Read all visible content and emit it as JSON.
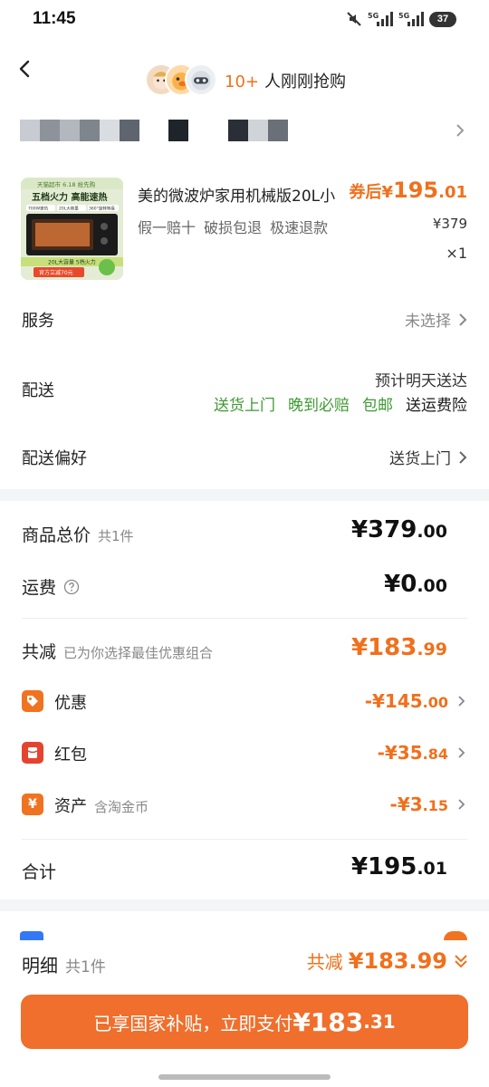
{
  "status_bar": {
    "time": "11:45",
    "battery": "37"
  },
  "header": {
    "buyers_count": "10+",
    "buyers_text": "人刚刚抢购"
  },
  "product": {
    "title": "美的微波炉家用机械版20L小",
    "tags": "假一赔十 破损包退 极速退款",
    "coupon_prefix": "券后¥",
    "coupon_int": "195",
    "coupon_dec": ".01",
    "original_price": "¥379",
    "quantity": "×1",
    "thumb": {
      "top_badge": "天猫超市 6.18 抢先购",
      "headline": "五档火力 高能速热",
      "chips": [
        "700W速热",
        "20L大容量",
        "360°旋转转盘"
      ],
      "bottom_line": "20L大容量 5档火力",
      "bottom_badge": "官方立减70元"
    }
  },
  "rows": {
    "service_label": "服务",
    "service_value": "未选择",
    "delivery_label": "配送",
    "delivery_eta": "预计明天送达",
    "delivery_tags": [
      "送货上门",
      "晚到必赔",
      "包邮"
    ],
    "delivery_insurance": "送运费险",
    "pref_label": "配送偏好",
    "pref_value": "送货上门"
  },
  "price": {
    "total_label": "商品总价",
    "total_count": "共1件",
    "total_int": "¥379",
    "total_dec": ".00",
    "freight_label": "运费",
    "freight_int": "¥0",
    "freight_dec": ".00",
    "reduce_label": "共减",
    "reduce_note": "已为你选择最佳优惠组合",
    "reduce_int": "¥183",
    "reduce_dec": ".99",
    "discounts": [
      {
        "icon_text": "⬥",
        "label": "优惠",
        "note": "",
        "int": "-¥145",
        "dec": ".00"
      },
      {
        "icon_text": "▤",
        "label": "红包",
        "note": "",
        "int": "-¥35",
        "dec": ".84"
      },
      {
        "icon_text": "¥",
        "label": "资产",
        "note": "含淘金币",
        "int": "-¥3",
        "dec": ".15"
      }
    ],
    "sum_label": "合计",
    "sum_int": "¥195",
    "sum_dec": ".01"
  },
  "bottom": {
    "detail_label": "明细",
    "detail_count": "共1件",
    "detail_reduce_prefix": "共减",
    "detail_reduce_value": "¥183.99",
    "pay_label": "已享国家补贴，立即支付",
    "pay_int": "¥183",
    "pay_dec": ".31"
  },
  "colors": {
    "accent": "#f0701c",
    "green": "#3e9a32",
    "button": "#f06f2c"
  },
  "icons": [
    "back-arrow-icon",
    "chevron-right-icon",
    "help-circle-icon",
    "coupon-tag-icon",
    "red-envelope-icon",
    "coin-icon",
    "double-chevron-down-icon"
  ]
}
